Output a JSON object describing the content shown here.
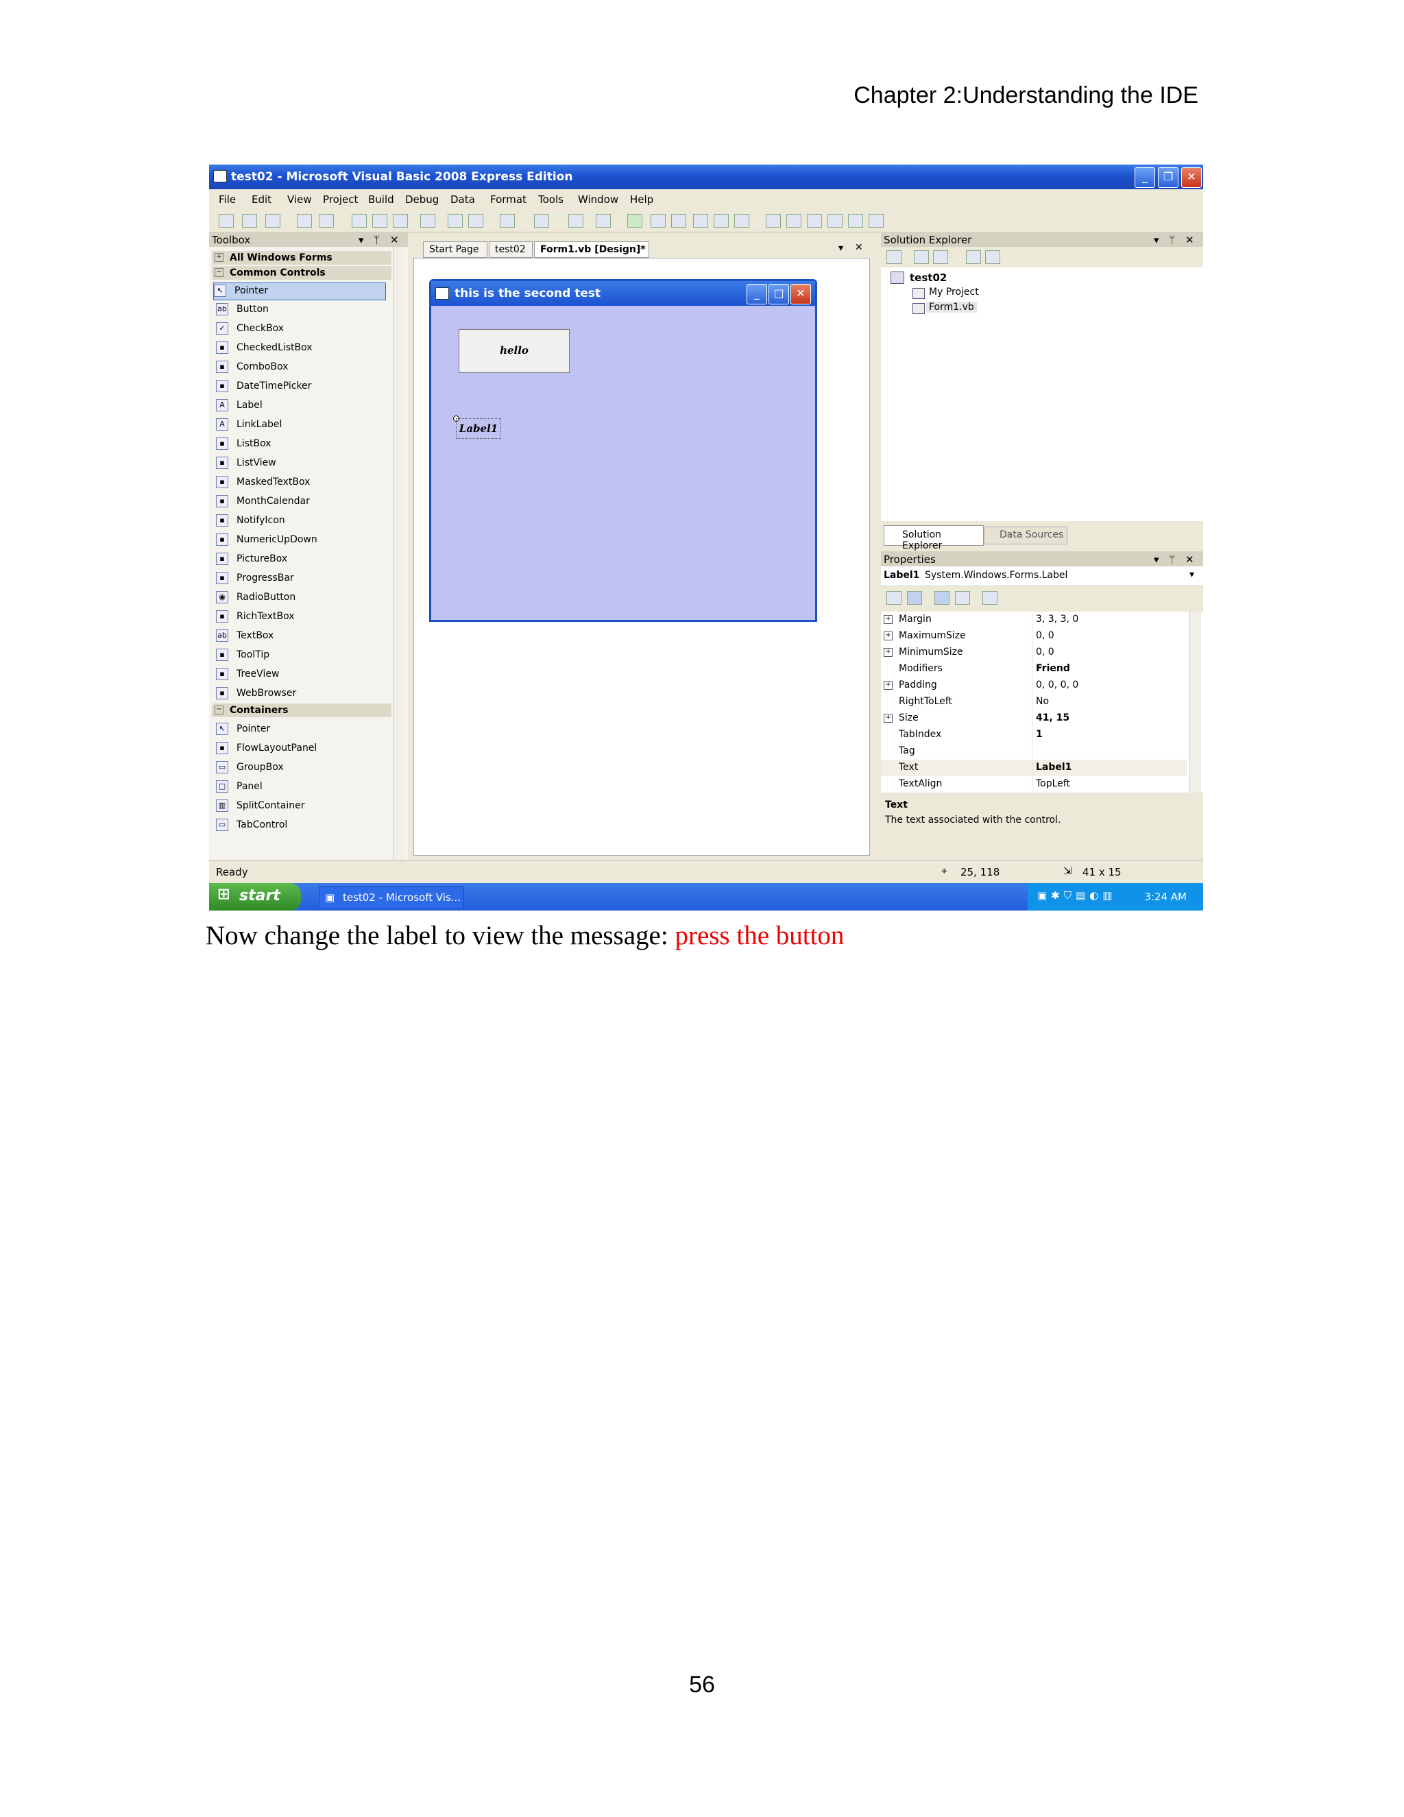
{
  "page": {
    "header": "Chapter 2:Understanding the IDE",
    "caption_prefix": "Now change the label to view the message: ",
    "caption_highlight": "press the button",
    "page_number": "56"
  },
  "window": {
    "title": "test02 - Microsoft Visual Basic 2008 Express Edition",
    "menu": [
      "File",
      "Edit",
      "View",
      "Project",
      "Build",
      "Debug",
      "Data",
      "Format",
      "Tools",
      "Window",
      "Help"
    ]
  },
  "toolbox": {
    "title": "Toolbox",
    "cat_all": "All Windows Forms",
    "cat_common": "Common Controls",
    "common_items": [
      "Pointer",
      "Button",
      "CheckBox",
      "CheckedListBox",
      "ComboBox",
      "DateTimePicker",
      "Label",
      "LinkLabel",
      "ListBox",
      "ListView",
      "MaskedTextBox",
      "MonthCalendar",
      "NotifyIcon",
      "NumericUpDown",
      "PictureBox",
      "ProgressBar",
      "RadioButton",
      "RichTextBox",
      "TextBox",
      "ToolTip",
      "TreeView",
      "WebBrowser"
    ],
    "cat_containers": "Containers",
    "container_items": [
      "Pointer",
      "FlowLayoutPanel",
      "GroupBox",
      "Panel",
      "SplitContainer",
      "TabControl"
    ]
  },
  "editor": {
    "tabs": [
      "Start Page",
      "test02",
      "Form1.vb [Design]*"
    ],
    "form_title": "this is the second test",
    "button_text": "hello",
    "label_text": "Label1"
  },
  "solution": {
    "title": "Solution Explorer",
    "root": "test02",
    "items": [
      "My Project",
      "Form1.vb"
    ],
    "tab1": "Solution Explorer",
    "tab2": "Data Sources"
  },
  "properties": {
    "title": "Properties",
    "object_name": "Label1",
    "object_type": "System.Windows.Forms.Label",
    "rows": [
      {
        "name": "Margin",
        "value": "3, 3, 3, 0",
        "expand": true,
        "bold": false
      },
      {
        "name": "MaximumSize",
        "value": "0, 0",
        "expand": true,
        "bold": false
      },
      {
        "name": "MinimumSize",
        "value": "0, 0",
        "expand": true,
        "bold": false
      },
      {
        "name": "Modifiers",
        "value": "Friend",
        "expand": false,
        "bold": true
      },
      {
        "name": "Padding",
        "value": "0, 0, 0, 0",
        "expand": true,
        "bold": false
      },
      {
        "name": "RightToLeft",
        "value": "No",
        "expand": false,
        "bold": false
      },
      {
        "name": "Size",
        "value": "41, 15",
        "expand": true,
        "bold": true
      },
      {
        "name": "TabIndex",
        "value": "1",
        "expand": false,
        "bold": true
      },
      {
        "name": "Tag",
        "value": "",
        "expand": false,
        "bold": false
      },
      {
        "name": "Text",
        "value": "Label1",
        "expand": false,
        "bold": true
      },
      {
        "name": "TextAlign",
        "value": "TopLeft",
        "expand": false,
        "bold": false
      }
    ],
    "desc_title": "Text",
    "desc_text": "The text associated with the control."
  },
  "status": {
    "ready": "Ready",
    "position": "25, 118",
    "size": "41 x 15"
  },
  "taskbar": {
    "start": "start",
    "task": "test02 - Microsoft Vis...",
    "clock": "3:24 AM"
  }
}
